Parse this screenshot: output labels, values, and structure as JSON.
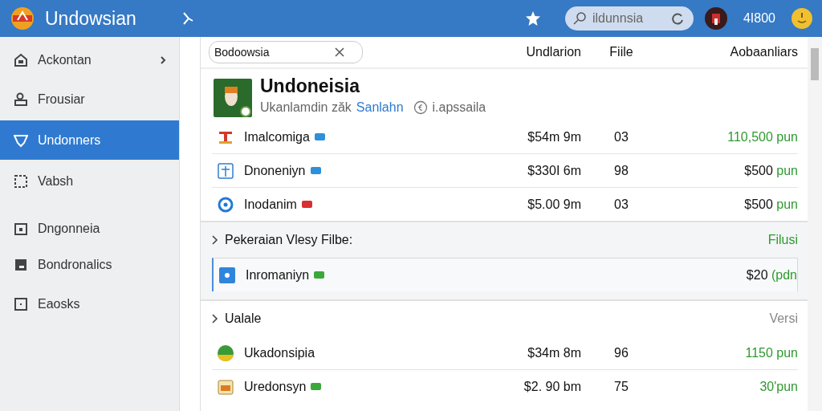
{
  "app": {
    "title": "Undowsian",
    "search": {
      "value": "ildunnsia"
    },
    "counter": "4I800"
  },
  "sidebar": {
    "items": [
      {
        "label": "Ackontan",
        "selected": false,
        "has_chevron": true
      },
      {
        "label": "Frousiar",
        "selected": false,
        "has_chevron": false
      },
      {
        "label": "Undonners",
        "selected": true,
        "has_chevron": false
      },
      {
        "label": "Vabsh",
        "selected": false,
        "has_chevron": false
      },
      {
        "label": "Dngonneia",
        "selected": false,
        "has_chevron": false
      },
      {
        "label": "Bondronalics",
        "selected": false,
        "has_chevron": false
      },
      {
        "label": "Eaosks",
        "selected": false,
        "has_chevron": false
      }
    ]
  },
  "filter": {
    "value": "Bodoowsia"
  },
  "columns": [
    "Undlarion",
    "Fiile",
    "Aobaanliars"
  ],
  "profile": {
    "name": "Undoneisia",
    "subtitle": "Ukanlamdin zăk",
    "link": "Sanlahn",
    "note": "i.apssaila"
  },
  "rows": [
    {
      "name": "Imalcomiga",
      "color": "#2f8fd8",
      "price": "$54m 9m",
      "count": "03",
      "total": [
        {
          "text": "110,500 pun",
          "kind": "accent"
        }
      ]
    },
    {
      "name": "Dnoneniyn",
      "color": "#2f8fd8",
      "price": "$330I 6m",
      "count": "98",
      "total": [
        {
          "text": "$500",
          "kind": "plain"
        },
        {
          "text": "pun",
          "kind": "accent"
        }
      ]
    },
    {
      "name": "Inodanim",
      "color": "#d83030",
      "price": "$5.00 9m",
      "count": "03",
      "total": [
        {
          "text": "$500",
          "kind": "plain"
        },
        {
          "text": "pun",
          "kind": "accent"
        }
      ]
    }
  ],
  "sections": [
    {
      "title": "Pekeraian Vlesy Filbe:",
      "side": "Filusi",
      "color": "#2e9a2e",
      "rows": [
        {
          "name": "Inromaniyn",
          "color": "#3aa83a",
          "highlighted": true,
          "total": [
            {
              "text": "$20",
              "kind": "plain"
            },
            {
              "text": "(pdn",
              "kind": "accent"
            }
          ]
        }
      ]
    },
    {
      "title": "Ualale",
      "side": "Versi",
      "color": "#888888",
      "rows": [
        {
          "name": "Ukadonsipia",
          "highlighted": false,
          "price": "$34m 8m",
          "count": "96",
          "total": [
            {
              "text": "1150 pun",
              "kind": "accent"
            }
          ]
        },
        {
          "name": "Uredonsyn",
          "color": "#3aa83a",
          "highlighted": false,
          "price": "$2. 90 bm",
          "count": "75",
          "total": [
            {
              "text": "30'pun",
              "kind": "accent"
            }
          ]
        }
      ]
    }
  ]
}
